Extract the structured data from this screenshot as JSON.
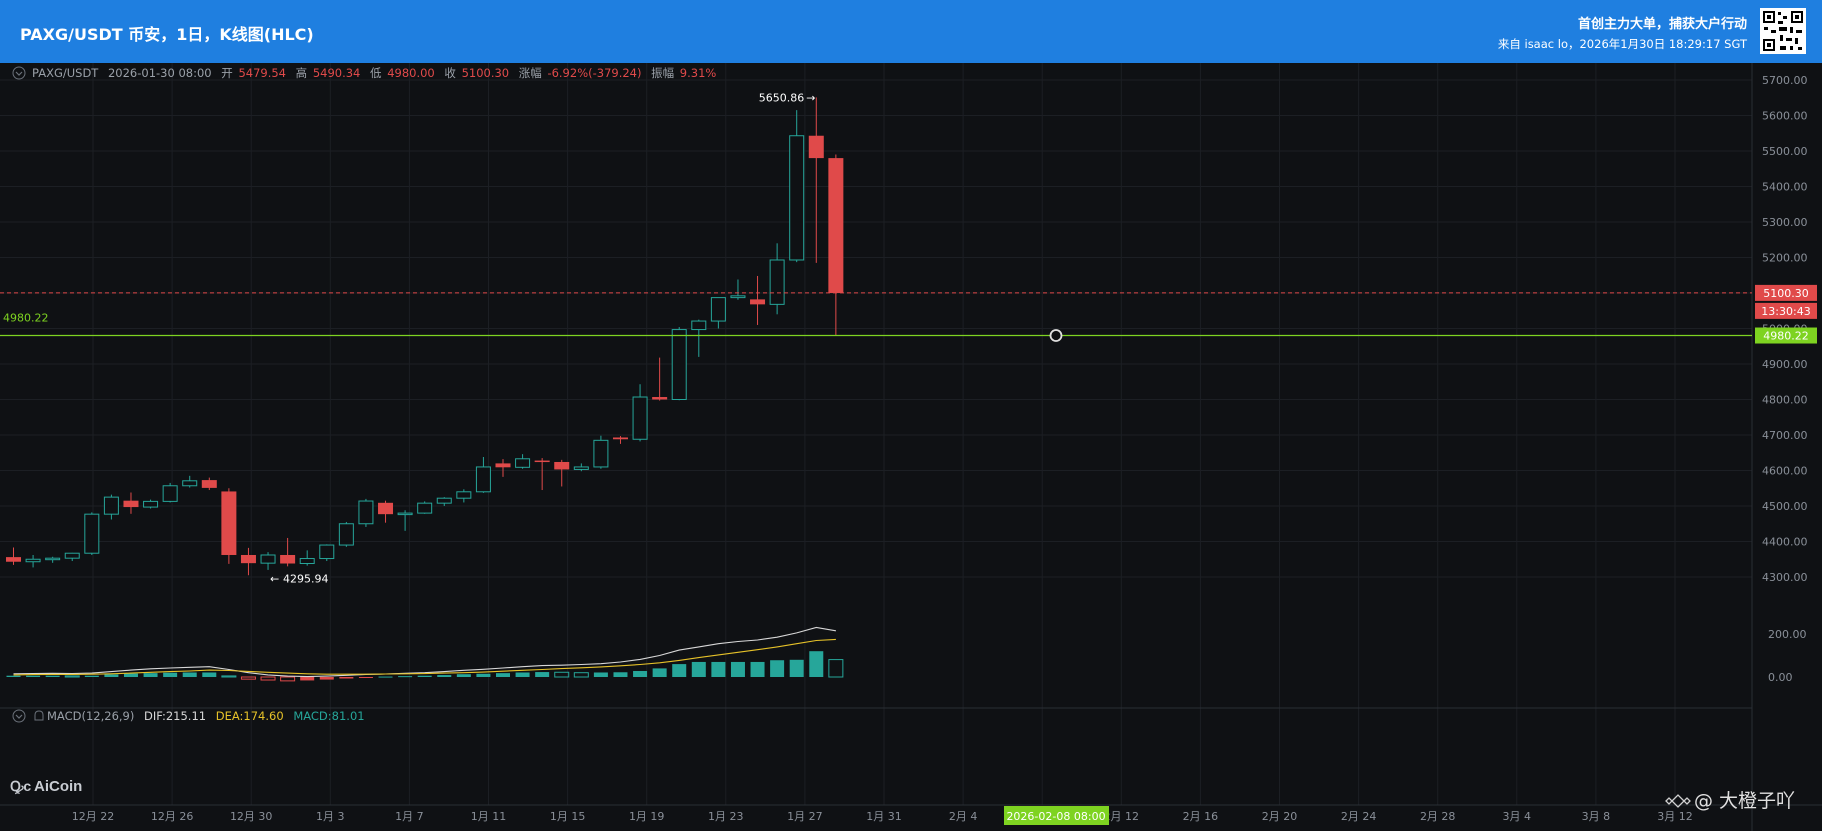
{
  "header": {
    "title": "PAXG/USDT 币安，1日，K线图(HLC)",
    "slogan": "首创主力大单，捕获大户行动",
    "source": "来自 isaac lo，2026年1月30日 18:29:17 SGT"
  },
  "info_bar": {
    "symbol": "PAXG/USDT",
    "datetime": "2026-01-30 08:00",
    "open_label": "开",
    "open": "5479.54",
    "high_label": "高",
    "high": "5490.34",
    "low_label": "低",
    "low": "4980.00",
    "close_label": "收",
    "close": "5100.30",
    "change_label": "涨幅",
    "change": "-6.92%(-379.24)",
    "amp_label": "振幅",
    "amp": "9.31%"
  },
  "macd_bar": {
    "name": "MACD(12,26,9)",
    "dif": "DIF:215.11",
    "dea": "DEA:174.60",
    "macd": "MACD:81.01"
  },
  "annotations": {
    "high_marker": "5650.86",
    "low_marker": "4295.94",
    "hline_label": "4980.22",
    "last_price": "5100.30",
    "countdown": "13:30:43",
    "hline_price": "4980.22",
    "crosshair_date": "2026-02-08 08:00"
  },
  "watermark": {
    "brand": "AiCoin",
    "author": "@ 大橙子吖"
  },
  "colors": {
    "up": "#26a69a",
    "down": "#e04a4a",
    "hline": "#7ed321",
    "dif": "#d8d8d8",
    "dea": "#e6c229",
    "header_bg": "#1f7fe0"
  },
  "chart_data": {
    "type": "candlestick",
    "price_axis": {
      "ticks": [
        "5700.00",
        "5600.00",
        "5500.00",
        "5400.00",
        "5300.00",
        "5200.00",
        "5100.00",
        "5000.00",
        "4900.00",
        "4800.00",
        "4700.00",
        "4600.00",
        "4500.00",
        "4400.00",
        "4300.00"
      ],
      "range": [
        4260,
        5760
      ]
    },
    "time_axis": {
      "ticks": [
        "12月 22",
        "12月 26",
        "12月 30",
        "1月 3",
        "1月 7",
        "1月 11",
        "1月 15",
        "1月 19",
        "1月 23",
        "1月 27",
        "1月 31",
        "2月 4",
        "2月 8",
        "2月 12",
        "2月 16",
        "2月 20",
        "2月 24",
        "2月 28",
        "3月 4",
        "3月 8",
        "3月 12"
      ]
    },
    "macd_axis": {
      "ticks": [
        "200.00",
        "0.00"
      ],
      "range": [
        -40,
        270
      ]
    },
    "candles": [
      {
        "o": 4356,
        "h": 4383,
        "l": 4334,
        "c": 4343
      },
      {
        "o": 4343,
        "h": 4362,
        "l": 4327,
        "c": 4350
      },
      {
        "o": 4350,
        "h": 4357,
        "l": 4340,
        "c": 4353
      },
      {
        "o": 4353,
        "h": 4368,
        "l": 4345,
        "c": 4367
      },
      {
        "o": 4367,
        "h": 4482,
        "l": 4362,
        "c": 4477
      },
      {
        "o": 4477,
        "h": 4532,
        "l": 4462,
        "c": 4525
      },
      {
        "o": 4515,
        "h": 4538,
        "l": 4478,
        "c": 4497
      },
      {
        "o": 4497,
        "h": 4518,
        "l": 4493,
        "c": 4513
      },
      {
        "o": 4513,
        "h": 4565,
        "l": 4510,
        "c": 4557
      },
      {
        "o": 4557,
        "h": 4585,
        "l": 4552,
        "c": 4571
      },
      {
        "o": 4573,
        "h": 4580,
        "l": 4545,
        "c": 4551
      },
      {
        "o": 4541,
        "h": 4550,
        "l": 4337,
        "c": 4362
      },
      {
        "o": 4362,
        "h": 4382,
        "l": 4305,
        "c": 4339
      },
      {
        "o": 4339,
        "h": 4370,
        "l": 4320,
        "c": 4362
      },
      {
        "o": 4362,
        "h": 4410,
        "l": 4330,
        "c": 4338
      },
      {
        "o": 4338,
        "h": 4375,
        "l": 4332,
        "c": 4352
      },
      {
        "o": 4352,
        "h": 4392,
        "l": 4345,
        "c": 4390
      },
      {
        "o": 4390,
        "h": 4455,
        "l": 4385,
        "c": 4450
      },
      {
        "o": 4450,
        "h": 4520,
        "l": 4441,
        "c": 4514
      },
      {
        "o": 4509,
        "h": 4515,
        "l": 4453,
        "c": 4477
      },
      {
        "o": 4477,
        "h": 4488,
        "l": 4430,
        "c": 4480
      },
      {
        "o": 4480,
        "h": 4513,
        "l": 4478,
        "c": 4508
      },
      {
        "o": 4508,
        "h": 4525,
        "l": 4500,
        "c": 4522
      },
      {
        "o": 4522,
        "h": 4547,
        "l": 4510,
        "c": 4540
      },
      {
        "o": 4540,
        "h": 4638,
        "l": 4537,
        "c": 4610
      },
      {
        "o": 4620,
        "h": 4632,
        "l": 4582,
        "c": 4609
      },
      {
        "o": 4609,
        "h": 4646,
        "l": 4605,
        "c": 4633
      },
      {
        "o": 4628,
        "h": 4635,
        "l": 4545,
        "c": 4624
      },
      {
        "o": 4624,
        "h": 4630,
        "l": 4555,
        "c": 4603
      },
      {
        "o": 4603,
        "h": 4620,
        "l": 4598,
        "c": 4610
      },
      {
        "o": 4610,
        "h": 4698,
        "l": 4605,
        "c": 4685
      },
      {
        "o": 4693,
        "h": 4697,
        "l": 4675,
        "c": 4688
      },
      {
        "o": 4688,
        "h": 4843,
        "l": 4682,
        "c": 4807
      },
      {
        "o": 4807,
        "h": 4918,
        "l": 4797,
        "c": 4800
      },
      {
        "o": 4800,
        "h": 5004,
        "l": 4798,
        "c": 4997
      },
      {
        "o": 4997,
        "h": 5025,
        "l": 4920,
        "c": 5021
      },
      {
        "o": 5021,
        "h": 5087,
        "l": 5000,
        "c": 5087
      },
      {
        "o": 5087,
        "h": 5138,
        "l": 5081,
        "c": 5092
      },
      {
        "o": 5082,
        "h": 5148,
        "l": 5010,
        "c": 5068
      },
      {
        "o": 5068,
        "h": 5240,
        "l": 5040,
        "c": 5193
      },
      {
        "o": 5193,
        "h": 5615,
        "l": 5187,
        "c": 5543
      },
      {
        "o": 5543,
        "h": 5651,
        "l": 5185,
        "c": 5480
      },
      {
        "o": 5480,
        "h": 5490,
        "l": 4980,
        "c": 5100
      }
    ],
    "macd": {
      "dif": [
        15,
        16,
        17,
        16,
        18,
        25,
        32,
        38,
        42,
        45,
        48,
        35,
        20,
        10,
        4,
        2,
        4,
        8,
        12,
        14,
        17,
        20,
        25,
        31,
        36,
        42,
        48,
        53,
        55,
        58,
        62,
        70,
        82,
        100,
        125,
        140,
        155,
        165,
        172,
        185,
        205,
        230,
        215
      ],
      "dea": [
        10,
        11,
        12,
        12,
        13,
        15,
        18,
        22,
        25,
        28,
        32,
        30,
        26,
        22,
        18,
        15,
        13,
        13,
        13,
        14,
        15,
        16,
        18,
        20,
        23,
        27,
        31,
        35,
        39,
        43,
        47,
        52,
        58,
        66,
        77,
        90,
        103,
        115,
        127,
        140,
        155,
        170,
        175
      ],
      "hist": [
        6,
        6,
        6,
        5,
        6,
        12,
        16,
        18,
        20,
        21,
        21,
        5,
        -10,
        -14,
        -18,
        -16,
        -12,
        -7,
        -2,
        2,
        4,
        6,
        9,
        13,
        15,
        18,
        21,
        23,
        22,
        20,
        21,
        22,
        28,
        40,
        60,
        70,
        70,
        70,
        70,
        78,
        80,
        120,
        81
      ]
    }
  }
}
